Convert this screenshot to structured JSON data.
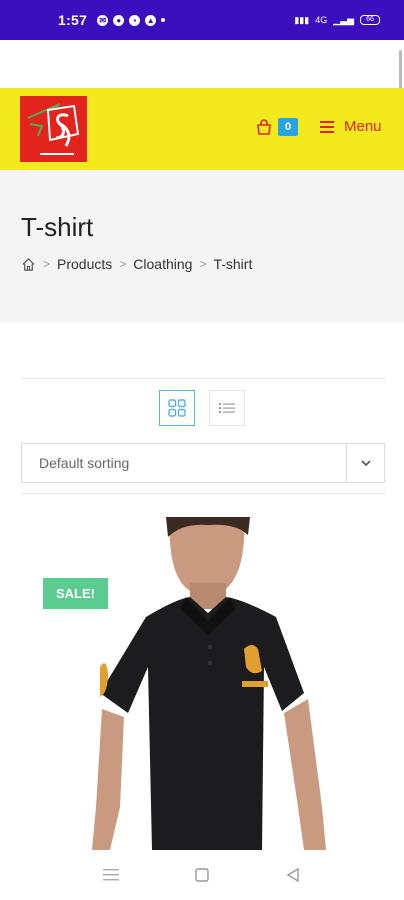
{
  "status_bar": {
    "time": "1:57",
    "notification_icons": [
      "messenger-icon",
      "chat-icon",
      "sim-icon",
      "gallery-icon"
    ],
    "right_text": "4G",
    "battery": "66"
  },
  "header": {
    "logo_letter": "a",
    "cart_count": "0",
    "menu_label": "Menu"
  },
  "page": {
    "title": "T-shirt",
    "breadcrumb": [
      "Products",
      "Cloathing",
      "T-shirt"
    ]
  },
  "toolbar": {
    "sorting_value": "Default sorting"
  },
  "product": {
    "sale_badge": "SALE!"
  },
  "colors": {
    "status_bar": "#3b0fbd",
    "header_bg": "#f2ea1c",
    "accent_red": "#e0241d",
    "cart_badge": "#29a3e6",
    "sale_badge": "#5ccb90"
  }
}
